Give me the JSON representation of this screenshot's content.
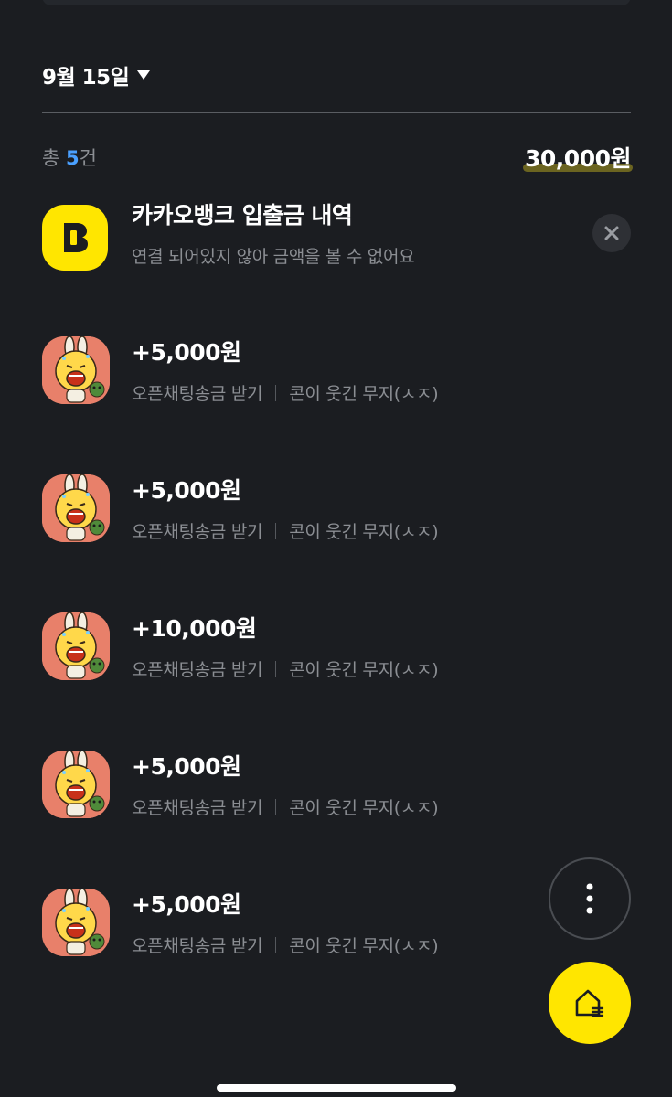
{
  "header": {
    "date_label": "9월 15일",
    "count_prefix": "총 ",
    "count_value": "5",
    "count_suffix": "건",
    "total_amount": "30,000원"
  },
  "bank": {
    "logo_letter": "B",
    "title": "카카오뱅크 입출금 내역",
    "subtitle": "연결 되어있지 않아 금액을 볼 수 없어요"
  },
  "transactions": [
    {
      "amount": "+5,000원",
      "type": "오픈채팅송금 받기",
      "sender": "콘이 웃긴 무지(ㅅㅈ)"
    },
    {
      "amount": "+5,000원",
      "type": "오픈채팅송금 받기",
      "sender": "콘이 웃긴 무지(ㅅㅈ)"
    },
    {
      "amount": "+10,000원",
      "type": "오픈채팅송금 받기",
      "sender": "콘이 웃긴 무지(ㅅㅈ)"
    },
    {
      "amount": "+5,000원",
      "type": "오픈채팅송금 받기",
      "sender": "콘이 웃긴 무지(ㅅㅈ)"
    },
    {
      "amount": "+5,000원",
      "type": "오픈채팅송금 받기",
      "sender": "콘이 웃긴 무지(ㅅㅈ)"
    }
  ],
  "icons": {
    "caret": "caret-down-icon",
    "close": "close-icon",
    "more": "more-vertical-icon",
    "home": "home-icon",
    "avatar": "muzi-emoticon-avatar"
  },
  "colors": {
    "background": "#1b1d21",
    "accent_yellow": "#ffe600",
    "count_blue": "#4aa0ff",
    "muted_text": "#8b8e93",
    "avatar_bg": "#e8806a"
  }
}
